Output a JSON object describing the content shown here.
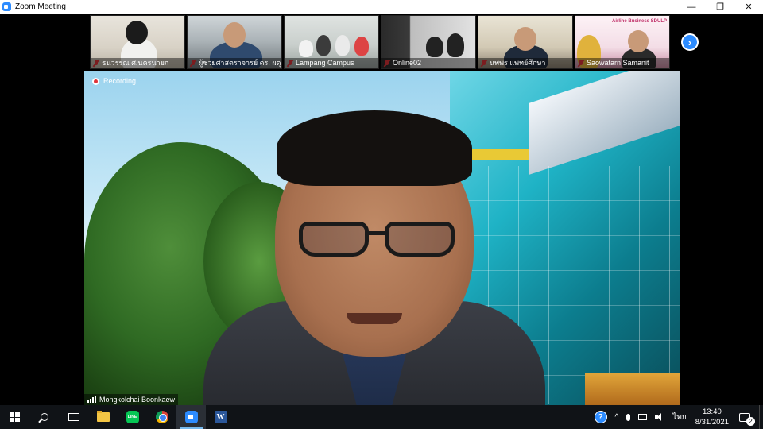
{
  "window": {
    "title": "Zoom Meeting",
    "minimize_glyph": "—",
    "restore_glyph": "❐",
    "close_glyph": "✕"
  },
  "recording": {
    "label": "Recording"
  },
  "thumbnails": [
    {
      "name": "ธนวรรณ  ศ.นครนายก",
      "muted": true
    },
    {
      "name": "ผู้ช่วยศาสตราจารย์ ดร. ผดุง ...",
      "muted": true
    },
    {
      "name": "Lampang Campus",
      "muted": true
    },
    {
      "name": "Online02",
      "muted": true
    },
    {
      "name": "นพพร แพทย์ศึกษา",
      "muted": true
    },
    {
      "name": "Saowatarn Samanit",
      "muted": true,
      "banner": "Airline Business SDULP"
    }
  ],
  "next_page_glyph": "›",
  "active_speaker": {
    "name": "Mongkolchai Boonkaew"
  },
  "taskbar": {
    "line_label": "LINE",
    "word_label": "W",
    "help_glyph": "?",
    "caret_glyph": "^",
    "language": "ไทย",
    "time": "13:40",
    "date": "8/31/2021",
    "notification_count": "2"
  },
  "colors": {
    "accent": "#2d8cff",
    "mute_red": "#e0343a",
    "taskbar_bg": "#101317"
  }
}
